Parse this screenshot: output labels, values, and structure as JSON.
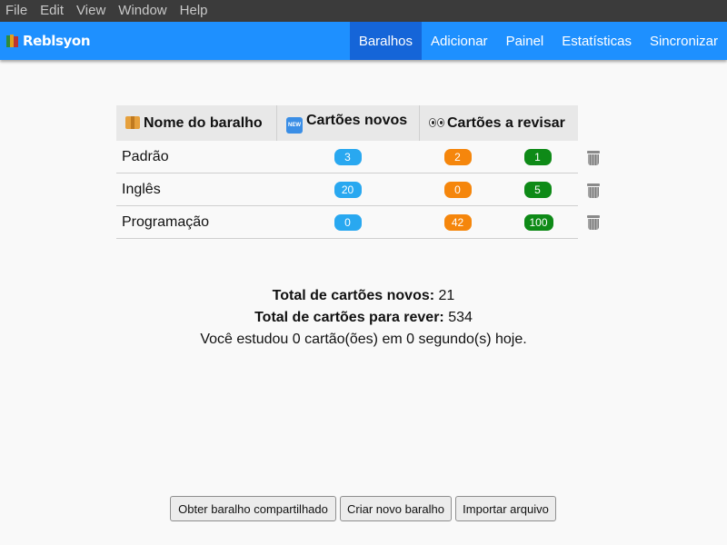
{
  "os_menu": [
    "File",
    "Edit",
    "View",
    "Window",
    "Help"
  ],
  "app": {
    "name": "Reblsyon",
    "logo_icon": "books-icon"
  },
  "nav": {
    "items": [
      "Baralhos",
      "Adicionar",
      "Painel",
      "Estatísticas",
      "Sincronizar"
    ],
    "active": "Baralhos",
    "color": "#1e90ff",
    "active_color": "#1565d8"
  },
  "table": {
    "headers": [
      {
        "icon": "package-icon",
        "label": "Nome do baralho"
      },
      {
        "icon": "new-icon",
        "label": "Cartões novos"
      },
      {
        "icon": "eyes-icon",
        "label": "Cartões a revisar"
      }
    ],
    "rows": [
      {
        "name": "Padrão",
        "new": "3",
        "learning": "2",
        "due": "1"
      },
      {
        "name": "Inglês",
        "new": "20",
        "learning": "0",
        "due": "5"
      },
      {
        "name": "Programação",
        "new": "0",
        "learning": "42",
        "due": "100"
      }
    ],
    "badge_colors": {
      "new": "#29a8f0",
      "learning": "#f5860c",
      "due": "#0e8a17"
    },
    "delete_icon": "trash-icon"
  },
  "summary": {
    "new_label": "Total de cartões novos:",
    "new_value": "21",
    "review_label": "Total de cartões para rever:",
    "review_value": "534",
    "studied_text": "Você estudou 0 cartão(ões) em 0 segundo(s) hoje."
  },
  "actions": {
    "shared": "Obter baralho compartilhado",
    "create": "Criar novo baralho",
    "import": "Importar arquivo"
  }
}
